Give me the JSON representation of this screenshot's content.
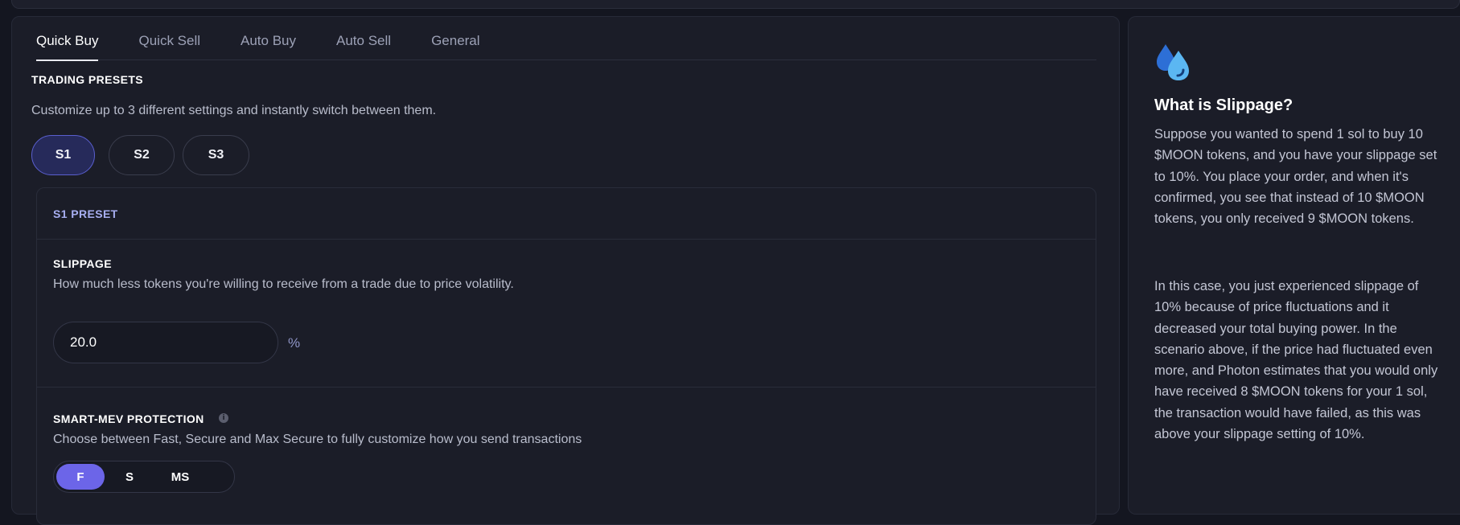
{
  "tabs": [
    {
      "label": "Quick Buy",
      "active": true
    },
    {
      "label": "Quick Sell",
      "active": false
    },
    {
      "label": "Auto Buy",
      "active": false
    },
    {
      "label": "Auto Sell",
      "active": false
    },
    {
      "label": "General",
      "active": false
    }
  ],
  "trading_presets": {
    "title": "TRADING PRESETS",
    "description": "Customize up to 3 different settings and instantly switch between them.",
    "presets": [
      "S1",
      "S2",
      "S3"
    ],
    "selected": "S1"
  },
  "preset_card": {
    "title": "S1 PRESET",
    "slippage": {
      "title": "SLIPPAGE",
      "description": "How much less tokens you're willing to receive from a trade due to price volatility.",
      "value": "20.0",
      "unit": "%"
    },
    "mev": {
      "title": "SMART-MEV PROTECTION",
      "description": "Choose between Fast, Secure and Max Secure to fully customize how you send transactions",
      "options": [
        "F",
        "S",
        "MS"
      ],
      "selected": "F"
    }
  },
  "info_panel": {
    "icon": "droplets-icon",
    "title": "What is Slippage?",
    "paragraphs": [
      "Suppose you wanted to spend 1 sol to buy 10 $MOON tokens, and you have your slippage set to 10%. You place your order, and when it's confirmed, you see that instead of 10 $MOON tokens, you only received 9 $MOON tokens.",
      "In this case, you just experienced slippage of 10% because of price fluctuations and it decreased your total buying power. In the scenario above, if the price had fluctuated even more, and Photon estimates that you would only have received 8 $MOON tokens for your 1 sol, the transaction would have failed, as this was above your slippage setting of 10%."
    ]
  },
  "colors": {
    "background": "#141620",
    "panel": "#1b1d28",
    "accent": "#6c65e8",
    "preset_active_bg": "#262a5a",
    "preset_label": "#a7aef0"
  }
}
